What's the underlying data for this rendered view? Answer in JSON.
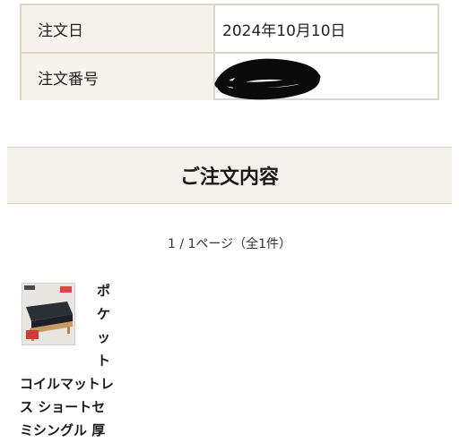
{
  "order_info": {
    "rows": [
      {
        "label": "注文日",
        "value": "2024年10月10日"
      },
      {
        "label": "注文番号",
        "value": ""
      }
    ]
  },
  "order_contents": {
    "heading": "ご注文内容",
    "pagination": "1 / 1ページ（全1件）"
  },
  "product": {
    "name_chars": [
      "ポ",
      "ケ",
      "ッ",
      "ト"
    ],
    "name_line_1": "コイルマットレ",
    "name_line_2": "ス ショートセ",
    "name_line_3": "ミシングル 厚"
  },
  "colors": {
    "label_bg": "#f6f3ec",
    "border": "#dcd6c9",
    "header_bg": "#f5f2eb"
  }
}
